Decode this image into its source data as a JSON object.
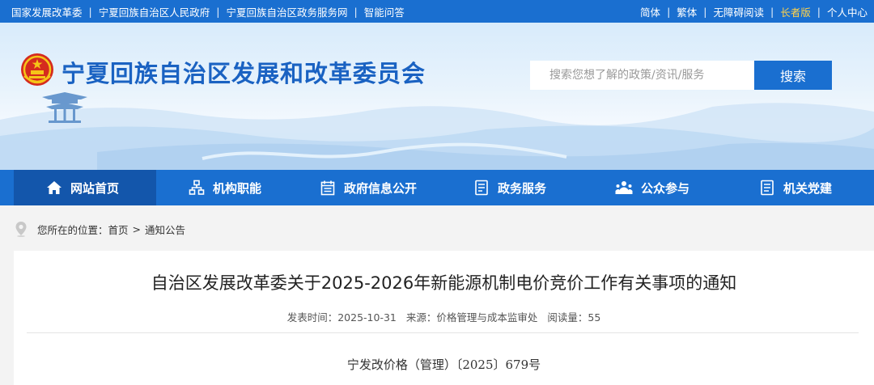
{
  "topbar": {
    "links": [
      "国家发展改革委",
      "宁夏回族自治区人民政府",
      "宁夏回族自治区政务服务网",
      "智能问答"
    ],
    "right_links": [
      "简体",
      "繁体",
      "无障碍阅读",
      "长者版",
      "个人中心"
    ],
    "accent_color": "#ffd24a"
  },
  "header": {
    "site_title": "宁夏回族自治区发展和改革委员会",
    "emblem_icon": "national-emblem-icon"
  },
  "search": {
    "placeholder": "搜索您想了解的政策/资讯/服务",
    "button_label": "搜索"
  },
  "nav": {
    "items": [
      {
        "label": "网站首页",
        "icon": "home-icon"
      },
      {
        "label": "机构职能",
        "icon": "org-chart-icon"
      },
      {
        "label": "政府信息公开",
        "icon": "calendar-doc-icon"
      },
      {
        "label": "政务服务",
        "icon": "service-doc-icon"
      },
      {
        "label": "公众参与",
        "icon": "people-icon"
      },
      {
        "label": "机关党建",
        "icon": "party-doc-icon"
      }
    ],
    "active_index": 0
  },
  "breadcrumb": {
    "prefix": "您所在的位置：",
    "items": [
      "首页",
      "通知公告"
    ],
    "separator": ">"
  },
  "article": {
    "title": "自治区发展改革委关于2025-2026年新能源机制电价竞价工作有关事项的通知",
    "publish_label": "发表时间：",
    "publish_date": "2025-10-31",
    "source_label": "来源：",
    "source": "价格管理与成本监审处",
    "views_label": "阅读量：",
    "views": "55",
    "doc_number": "宁发改价格（管理）〔2025〕679号"
  },
  "colors": {
    "primary": "#1a6fd0",
    "nav_active": "#1356ab",
    "title_blue": "#1a62c2"
  }
}
